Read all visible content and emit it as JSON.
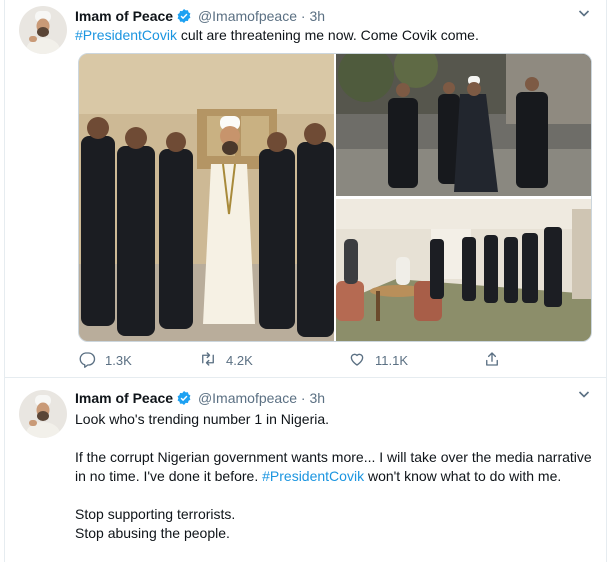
{
  "tweets": [
    {
      "name": "Imam of Peace",
      "handle": "@Imamofpeace",
      "separator": "·",
      "time": "3h",
      "text_hashtag": "#PresidentCovik",
      "text_rest": " cult are threatening me now. Come Covik come.",
      "stats": {
        "replies": "1.3K",
        "retweets": "4.2K",
        "likes": "11.1K"
      },
      "photo_count": 3
    },
    {
      "name": "Imam of Peace",
      "handle": "@Imamofpeace",
      "separator": "·",
      "time": "3h",
      "para1": "Look who's trending number 1 in Nigeria.",
      "para2_before": "If the corrupt Nigerian government wants more... I will take over the media narrative in no time. I've done it before. ",
      "para2_hashtag": "#PresidentCovik",
      "para2_after": " won't know what to do with me.",
      "para3_line1": "Stop supporting terrorists.",
      "para3_line2": "Stop abusing the people."
    }
  ],
  "colors": {
    "accent": "#1b95e0",
    "verified": "#1da1f2",
    "muted": "#5b7083"
  },
  "icons": [
    "verified-badge-icon",
    "chevron-down-icon",
    "reply-icon",
    "retweet-icon",
    "like-icon",
    "share-icon"
  ]
}
